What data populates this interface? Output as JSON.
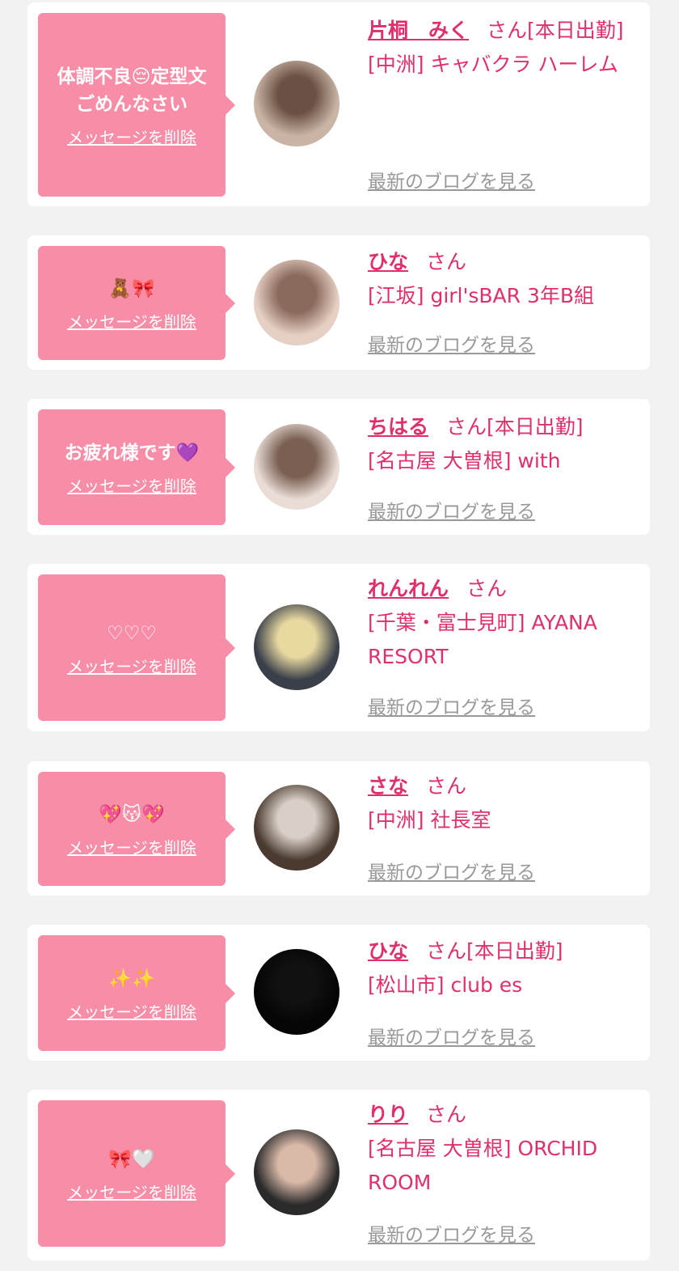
{
  "messages": [
    {
      "text": "体調不良😔定型文\nごめんなさい",
      "delete_label": "メッセージを削除",
      "name": "片桐　みく",
      "san": "さん",
      "status": "[本日出勤]",
      "shop": "[中洲] キャバクラ ハーレム",
      "blog_label": "最新のブログを見る",
      "avatar_colors": [
        "#c9b4a6",
        "#6b5145"
      ]
    },
    {
      "text": "🧸🎀",
      "delete_label": "メッセージを削除",
      "name": "ひな",
      "san": "さん",
      "status": "",
      "shop": "[江坂] girl'sBAR 3年B組",
      "blog_label": "最新のブログを見る",
      "avatar_colors": [
        "#e6cfc4",
        "#8a6a5c"
      ]
    },
    {
      "text": "お疲れ様です💜",
      "delete_label": "メッセージを削除",
      "name": "ちはる",
      "san": "さん",
      "status": "[本日出勤]",
      "shop": "[名古屋 大曽根] with",
      "blog_label": "最新のブログを見る",
      "avatar_colors": [
        "#e9ddd6",
        "#7a5f52"
      ]
    },
    {
      "text": "♡♡♡",
      "delete_label": "メッセージを削除",
      "name": "れんれん",
      "san": "さん",
      "status": "",
      "shop": "[千葉・富士見町] AYANA RESORT",
      "blog_label": "最新のブログを見る",
      "avatar_colors": [
        "#3a3f4a",
        "#e8d9a0"
      ]
    },
    {
      "text": "💖😽💖",
      "delete_label": "メッセージを削除",
      "name": "さな",
      "san": "さん",
      "status": "",
      "shop": "[中洲] 社長室",
      "blog_label": "最新のブログを見る",
      "avatar_colors": [
        "#4a3a30",
        "#d8cfc6"
      ]
    },
    {
      "text": "✨✨",
      "delete_label": "メッセージを削除",
      "name": "ひな",
      "san": "さん",
      "status": "[本日出勤]",
      "shop": "[松山市] club es",
      "blog_label": "最新のブログを見る",
      "avatar_colors": [
        "#050505",
        "#111111"
      ]
    },
    {
      "text": "🎀🤍",
      "delete_label": "メッセージを削除",
      "name": "りり",
      "san": "さん",
      "status": "",
      "shop": "[名古屋 大曽根] ORCHID ROOM",
      "blog_label": "最新のブログを見る",
      "avatar_colors": [
        "#2a2a2a",
        "#d9b9a8"
      ]
    }
  ]
}
